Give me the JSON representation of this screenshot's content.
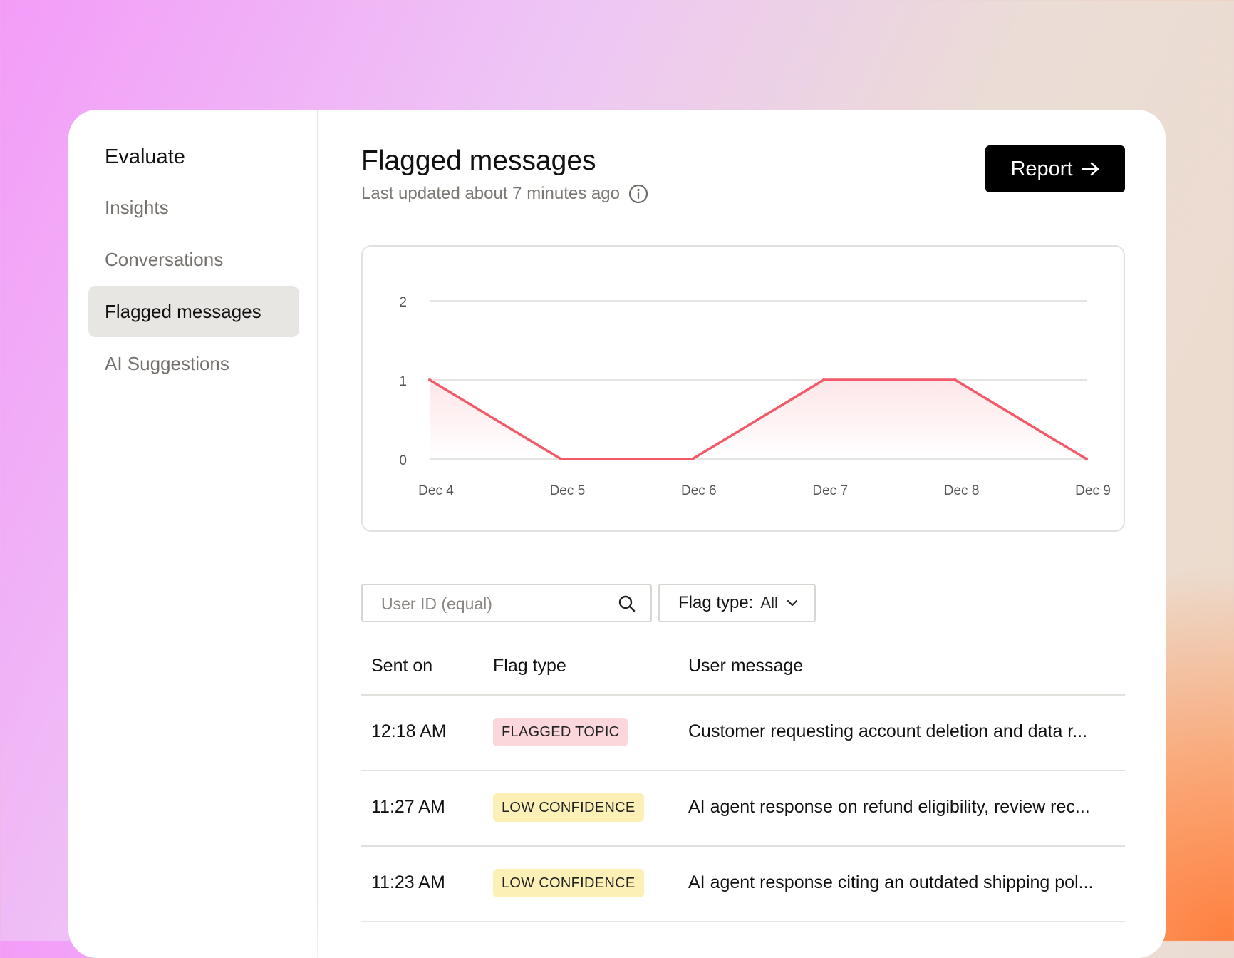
{
  "sidebar": {
    "title": "Evaluate",
    "items": [
      {
        "label": "Insights",
        "active": false
      },
      {
        "label": "Conversations",
        "active": false
      },
      {
        "label": "Flagged messages",
        "active": true
      },
      {
        "label": "AI Suggestions",
        "active": false
      }
    ]
  },
  "header": {
    "title": "Flagged messages",
    "subtitle": "Last updated about 7 minutes ago",
    "report_label": "Report",
    "report_icon": "arrow-right-icon",
    "info_icon": "info-icon"
  },
  "chart_data": {
    "type": "area",
    "categories": [
      "Dec 4",
      "Dec 5",
      "Dec 6",
      "Dec 7",
      "Dec 8",
      "Dec 9"
    ],
    "y_ticks": [
      0,
      1,
      2
    ],
    "ylim": [
      0,
      2
    ],
    "series": [
      {
        "values": [
          1,
          0,
          0,
          1,
          1,
          0
        ],
        "color": "#f25a6a"
      }
    ],
    "grid": true
  },
  "filters": {
    "search_placeholder": "User ID (equal)",
    "search_value": "",
    "flag_type_label": "Flag type:",
    "flag_type_value": "All"
  },
  "table": {
    "columns": [
      "Sent on",
      "Flag type",
      "User message"
    ],
    "rows": [
      {
        "sent_on": "12:18 AM",
        "flag_type": "FLAGGED TOPIC",
        "flag_color": "#fbd7dc",
        "message": "Customer requesting account deletion and data r..."
      },
      {
        "sent_on": "11:27 AM",
        "flag_type": "LOW CONFIDENCE",
        "flag_color": "#fdf0b6",
        "message": "AI agent response on refund eligibility, review rec..."
      },
      {
        "sent_on": "11:23 AM",
        "flag_type": "LOW CONFIDENCE",
        "flag_color": "#fdf0b6",
        "message": "AI agent response citing an outdated shipping pol..."
      }
    ]
  }
}
